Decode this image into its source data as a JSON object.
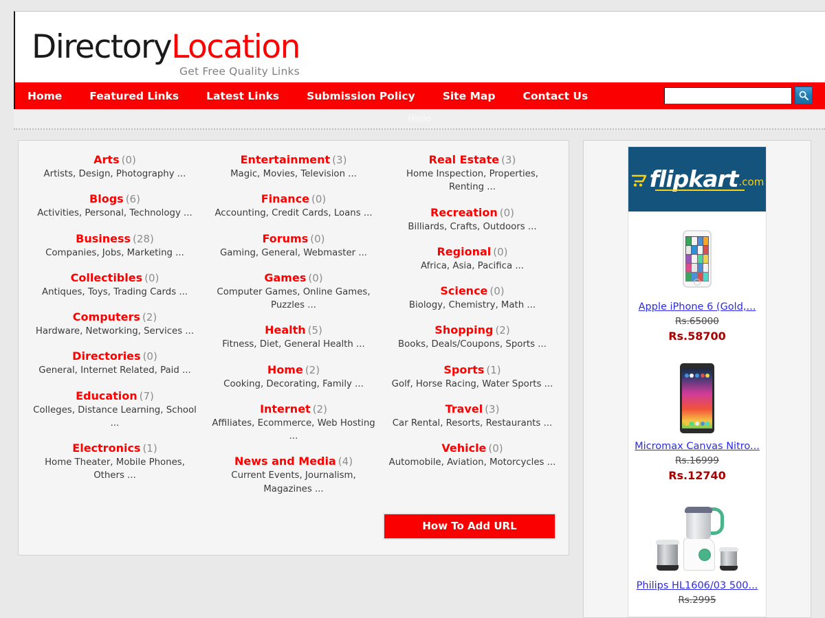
{
  "site": {
    "logo_first": "Directory",
    "logo_second": "Location",
    "tagline": "Get Free Quality Links"
  },
  "nav": {
    "items": [
      {
        "label": "Home"
      },
      {
        "label": "Featured Links"
      },
      {
        "label": "Latest Links"
      },
      {
        "label": "Submission Policy"
      },
      {
        "label": "Site Map"
      },
      {
        "label": "Contact Us"
      }
    ],
    "search": {
      "value": "",
      "placeholder": "",
      "icon": "search-icon"
    }
  },
  "greeting": {
    "text": "Hello"
  },
  "categories": {
    "columns": [
      [
        {
          "name": "Arts",
          "count": "(0)",
          "subs": "Artists, Design, Photography ..."
        },
        {
          "name": "Blogs",
          "count": "(6)",
          "subs": "Activities, Personal, Technology ..."
        },
        {
          "name": "Business",
          "count": "(28)",
          "subs": "Companies, Jobs, Marketing ..."
        },
        {
          "name": "Collectibles",
          "count": "(0)",
          "subs": "Antiques, Toys, Trading Cards ..."
        },
        {
          "name": "Computers",
          "count": "(2)",
          "subs": "Hardware, Networking, Services ..."
        },
        {
          "name": "Directories",
          "count": "(0)",
          "subs": "General, Internet Related, Paid ..."
        },
        {
          "name": "Education",
          "count": "(7)",
          "subs": "Colleges, Distance Learning, School ..."
        },
        {
          "name": "Electronics",
          "count": "(1)",
          "subs": "Home Theater, Mobile Phones, Others ..."
        }
      ],
      [
        {
          "name": "Entertainment",
          "count": "(3)",
          "subs": "Magic, Movies, Television ..."
        },
        {
          "name": "Finance",
          "count": "(0)",
          "subs": "Accounting, Credit Cards, Loans ..."
        },
        {
          "name": "Forums",
          "count": "(0)",
          "subs": "Gaming, General, Webmaster ..."
        },
        {
          "name": "Games",
          "count": "(0)",
          "subs": "Computer Games, Online Games, Puzzles ..."
        },
        {
          "name": "Health",
          "count": "(5)",
          "subs": "Fitness, Diet, General Health ..."
        },
        {
          "name": "Home",
          "count": "(2)",
          "subs": "Cooking, Decorating, Family ..."
        },
        {
          "name": "Internet",
          "count": "(2)",
          "subs": "Affiliates, Ecommerce, Web Hosting ..."
        },
        {
          "name": "News and Media",
          "count": "(4)",
          "subs": "Current Events, Journalism, Magazines ..."
        }
      ],
      [
        {
          "name": "Real Estate",
          "count": "(3)",
          "subs": "Home Inspection, Properties, Renting ..."
        },
        {
          "name": "Recreation",
          "count": "(0)",
          "subs": "Billiards, Crafts, Outdoors ..."
        },
        {
          "name": "Regional",
          "count": "(0)",
          "subs": "Africa, Asia, Pacifica ..."
        },
        {
          "name": "Science",
          "count": "(0)",
          "subs": "Biology, Chemistry, Math ..."
        },
        {
          "name": "Shopping",
          "count": "(2)",
          "subs": "Books, Deals/Coupons, Sports ..."
        },
        {
          "name": "Sports",
          "count": "(1)",
          "subs": "Golf, Horse Racing, Water Sports ..."
        },
        {
          "name": "Travel",
          "count": "(3)",
          "subs": "Car Rental, Resorts, Restaurants ..."
        },
        {
          "name": "Vehicle",
          "count": "(0)",
          "subs": "Automobile, Aviation, Motorcycles ..."
        }
      ]
    ],
    "add_url_label": "How To Add URL"
  },
  "sidebar": {
    "ad": {
      "brand_word": "flipkart",
      "brand_tld": ".com",
      "products": [
        {
          "title": "Apple iPhone 6 (Gold,...",
          "price_old": "Rs.65000",
          "price_new": "Rs.58700",
          "image": "iphone-product-image"
        },
        {
          "title": "Micromax Canvas Nitro...",
          "price_old": "Rs.16999",
          "price_new": "Rs.12740",
          "image": "micromax-product-image"
        },
        {
          "title": "Philips HL1606/03 500...",
          "price_old": "Rs.2995",
          "price_new": "",
          "image": "mixer-product-image"
        }
      ]
    }
  },
  "colors": {
    "brand_red": "#ff0000",
    "nav_red": "#fb0000",
    "flipkart_blue": "#13537c",
    "flipkart_yellow": "#f7d117",
    "link_blue": "#2a2ae8",
    "price_red": "#a80000"
  }
}
